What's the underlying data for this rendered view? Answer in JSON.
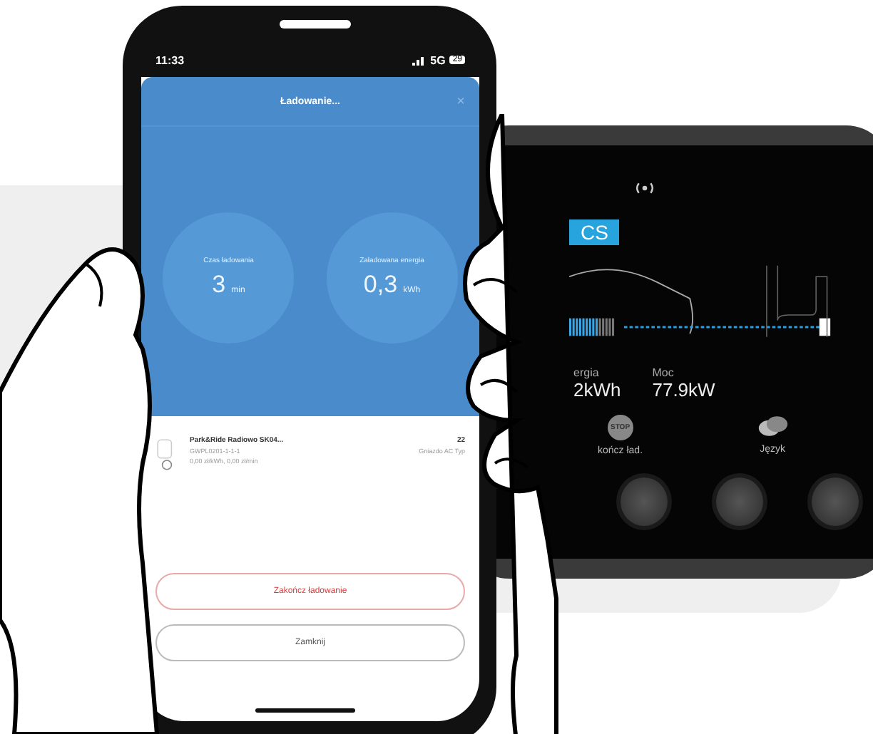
{
  "phone": {
    "status_bar": {
      "time": "11:33",
      "network": "5G",
      "battery": "29"
    },
    "title": "Ładowanie...",
    "close": "×",
    "stats": [
      {
        "label": "Czas ładowania",
        "value": "3",
        "unit": "min"
      },
      {
        "label": "Załadowana energia",
        "value": "0,3",
        "unit": "kWh"
      }
    ],
    "station": {
      "name": "Park&Ride Radiowo SK04...",
      "code": "GWPL0201-1-1-1",
      "price": "0,00 zł/kWh, 0,00 zł/min",
      "power": "22",
      "connector": "Gniazdo AC Typ"
    },
    "buttons": [
      {
        "label": "Zakończ ładowanie",
        "kind": "danger"
      },
      {
        "label": "Zamknij",
        "kind": "plain"
      }
    ]
  },
  "charger": {
    "badge": "CS",
    "readings": [
      {
        "label": "ergia",
        "value": "2kWh"
      },
      {
        "label": "Moc",
        "value": "77.9kW"
      }
    ],
    "actions": [
      {
        "label": "kończ ład.",
        "icon_text": "STOP",
        "kind": "stop"
      },
      {
        "label": "Język",
        "kind": "language"
      }
    ]
  }
}
